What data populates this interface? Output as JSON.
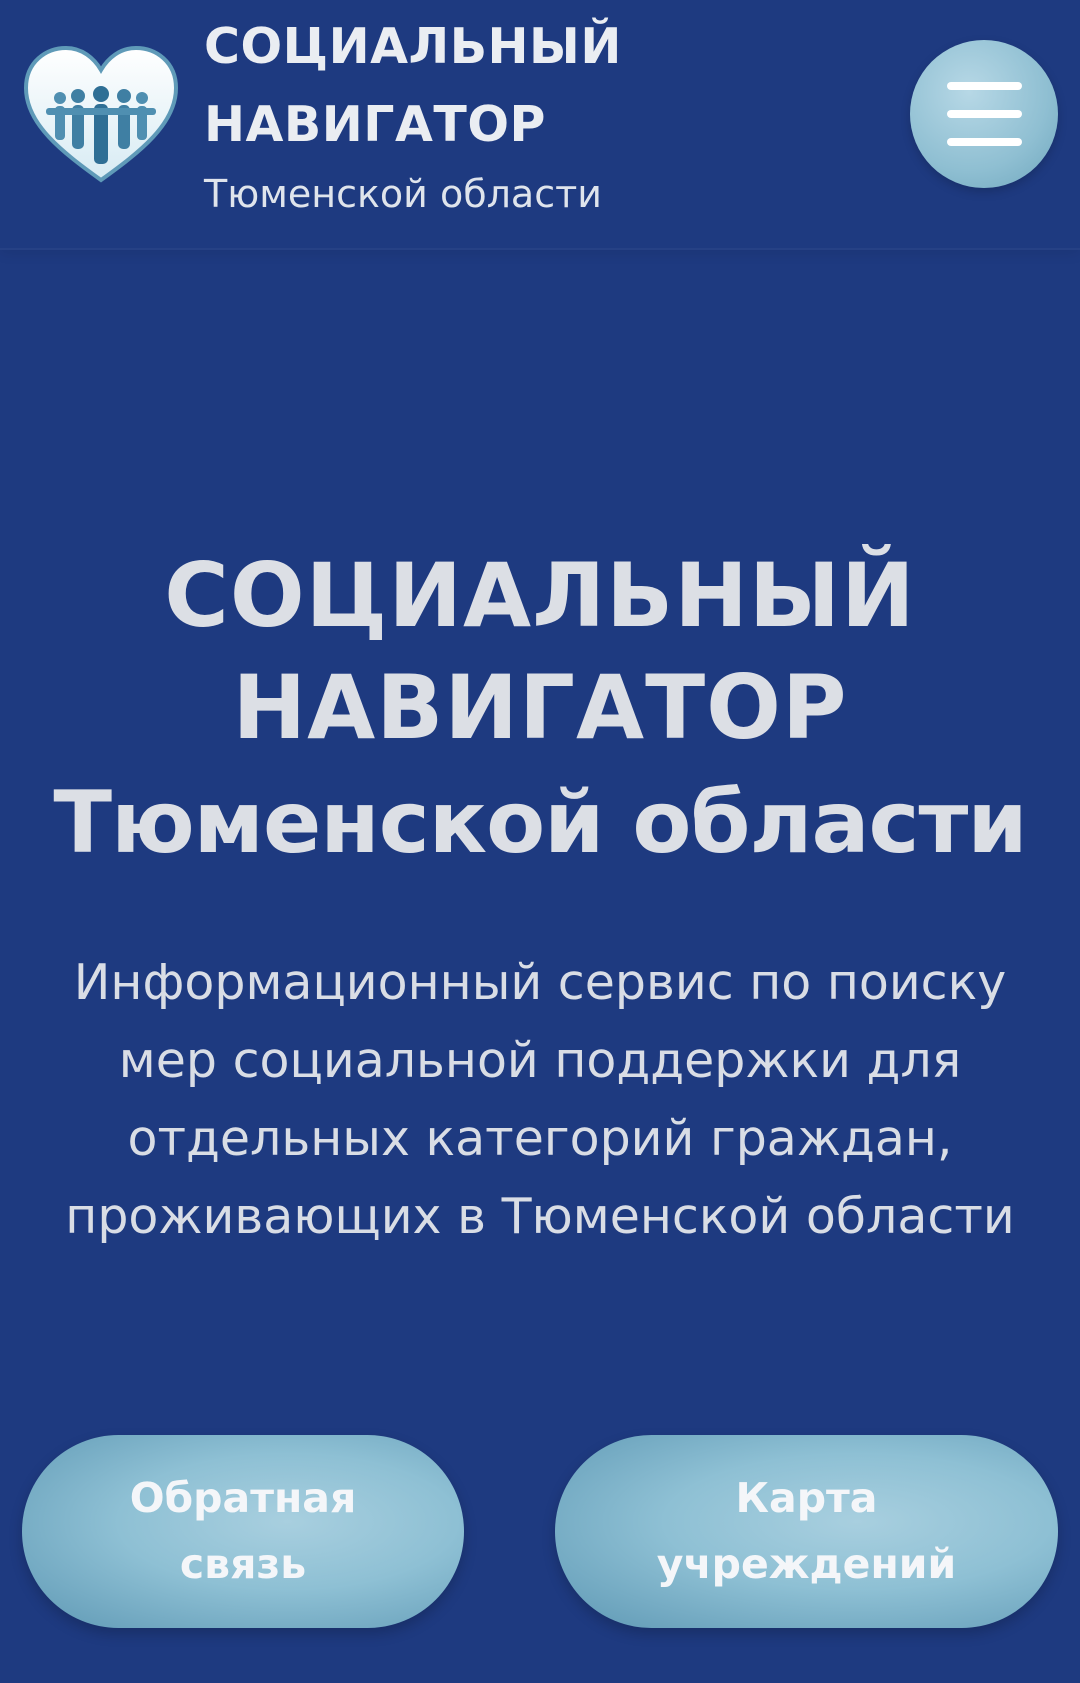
{
  "header": {
    "brand_line1": "СОЦИАЛЬНЫЙ",
    "brand_line2": "НАВИГАТОР",
    "brand_sub": "Тюменской области",
    "logo_icon": "heart-people-logo-icon",
    "menu_icon": "hamburger-menu-icon"
  },
  "hero": {
    "title_line1": "СОЦИАЛЬНЫЙ",
    "title_line2": "НАВИГАТОР",
    "title_line3": "Тюменской области",
    "desc_line1": "Информационный сервис по поиску",
    "desc_line2": "мер социальной поддержки для",
    "desc_line3": "отдельных категорий граждан,",
    "desc_line4": "проживающих в Тюменской области"
  },
  "actions": {
    "feedback_line1": "Обратная",
    "feedback_line2": "связь",
    "map_line1": "Карта",
    "map_line2": "учреждений"
  },
  "colors": {
    "background": "#1e3a80",
    "accent": "#8ec0d4",
    "text": "#dcdfe5"
  }
}
